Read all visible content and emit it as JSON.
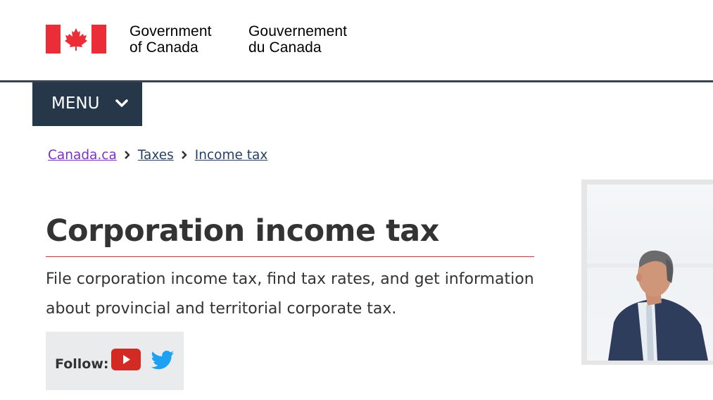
{
  "header": {
    "logo": {
      "icon": "canada-flag-icon",
      "colors": {
        "red": "#eb2d37",
        "white": "#ffffff"
      }
    },
    "signature_en": [
      "Government",
      "of Canada"
    ],
    "signature_fr": [
      "Gouvernement",
      "du Canada"
    ]
  },
  "nav": {
    "menu_label": "MENU",
    "menu_icon": "chevron-down-icon",
    "menu_bg": "#26374a"
  },
  "breadcrumb": {
    "items": [
      {
        "label": "Canada.ca"
      },
      {
        "label": "Taxes"
      },
      {
        "label": "Income tax"
      }
    ],
    "separator_icon": "chevron-right-icon"
  },
  "main": {
    "title": "Corporation income tax",
    "lead": "File corporation income tax, find tax rates, and get information about provincial and territorial corporate tax."
  },
  "follow": {
    "label": "Follow:",
    "icons": [
      "youtube-icon",
      "twitter-icon"
    ],
    "colors": {
      "youtube": "#d32a23",
      "twitter": "#1da1f2"
    }
  },
  "feature_image": {
    "icon": "businessman-photo"
  }
}
